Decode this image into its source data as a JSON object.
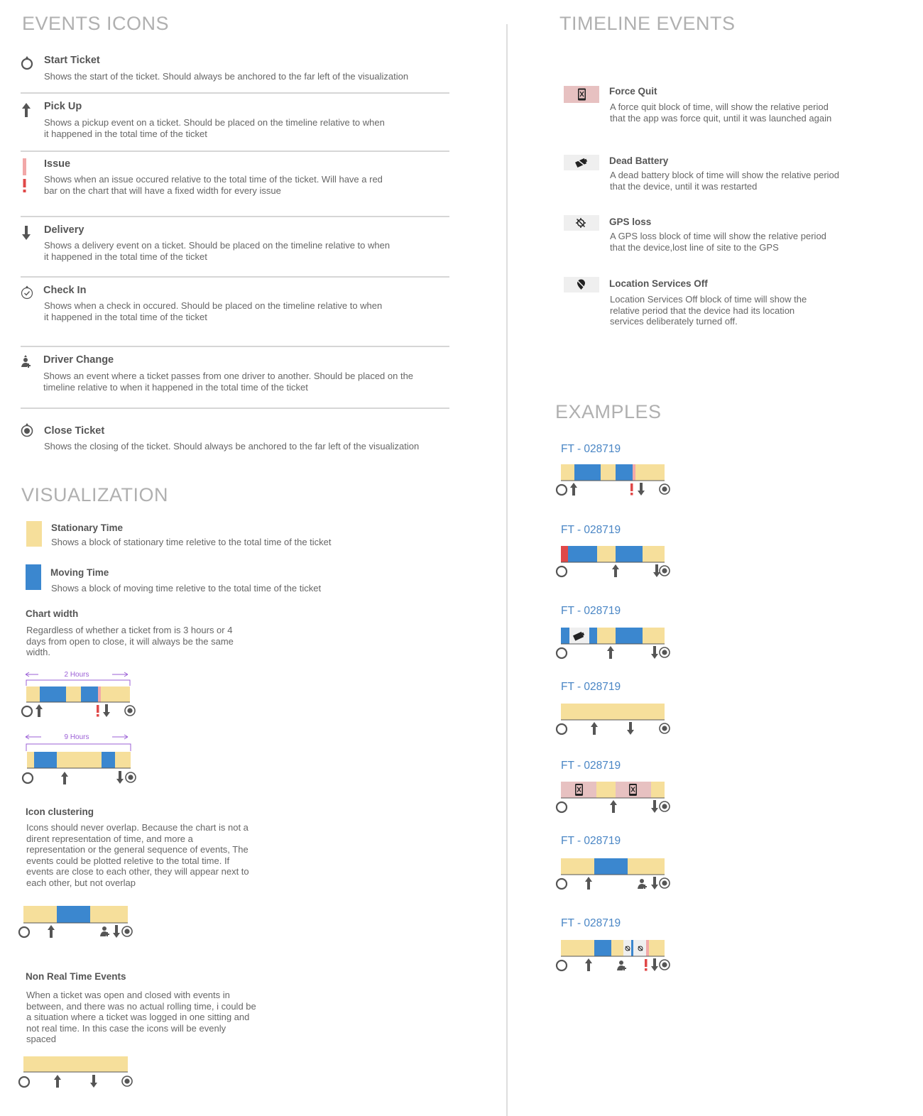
{
  "colors": {
    "stationary": "#f6df9b",
    "moving": "#3b87cf",
    "issue": "#f2a0a0",
    "issue_strong": "#e04848",
    "force_quit": "#e7c1c1",
    "dark_icon": "#555555",
    "heading": "#b0b0b0",
    "purple": "#9b5fd6",
    "label_blue": "#4a86c5"
  },
  "events_icons": {
    "heading": "EVENTS ICONS",
    "items": [
      {
        "icon": "start-circle-icon",
        "title": "Start Ticket",
        "desc": "Shows the start of the ticket. Should always be anchored to the far left of the visualization"
      },
      {
        "icon": "arrow-up-icon",
        "title": "Pick Up",
        "desc": "Shows a pickup  event on a ticket. Should be placed on the timeline relative to when it happened in the total time of the ticket"
      },
      {
        "icon": "issue-exclamation-icon",
        "title": "Issue",
        "desc": "Shows when an issue occured relative to the total time of the ticket. Will have a red bar on the chart that will have a fixed width for every issue"
      },
      {
        "icon": "arrow-down-icon",
        "title": "Delivery",
        "desc": "Shows a delivery event on a ticket. Should be placed on the timeline relative to when it happened in the total time of the ticket"
      },
      {
        "icon": "check-circle-icon",
        "title": "Check In",
        "desc": "Shows when a check in occured. Should be placed on the timeline relative to when it happened in the total time of the ticket"
      },
      {
        "icon": "driver-change-icon",
        "title": "Driver Change",
        "desc": "Shows an event where a ticket passes from one driver to another. Should be placed on the timeline relative to when it happened in the total time of the ticket"
      },
      {
        "icon": "close-circle-icon",
        "title": "Close Ticket",
        "desc": "Shows the closing of the ticket. Should always be anchored to the far left of the visualization"
      }
    ]
  },
  "visualization": {
    "heading": "VISUALIZATION",
    "stationary": {
      "title": "Stationary Time",
      "desc": "Shows a block of stationary time reletive to the total time of the ticket"
    },
    "moving": {
      "title": "Moving Time",
      "desc": "Shows a block of moving time reletive to the total time of the ticket"
    },
    "chart_width": {
      "title": "Chart width",
      "desc": "Regardless of whether a ticket from is 3 hours or 4 days from open to close, it will  always be the same width.",
      "label_a": "2 Hours",
      "label_b": "9 Hours"
    },
    "icon_clustering": {
      "title": "Icon clustering",
      "desc": "Icons should never overlap. Because the chart is not a dirent representation of time, and more a representation or the general sequence of events, The events could be plotted reletive to the total time. If events are close to each other, they will appear next to each other, but not overlap"
    },
    "non_real_time": {
      "title": "Non Real Time Events",
      "desc": "When a ticket was open and closed with events in between, and there was no actual rolling time, i could be a situation where a ticket was logged in one sitting and not real time. In this case the icons will be evenly spaced"
    }
  },
  "timeline_events": {
    "heading": "TIMELINE EVENTS",
    "items": [
      {
        "icon": "phone-x-icon",
        "title": "Force Quit",
        "desc": "A force quit block of time, will show the relative period that the app was force quit, until it was launched again"
      },
      {
        "icon": "dead-battery-icon",
        "title": "Dead Battery",
        "desc": "A dead battery block of time will show the relative period that the device, until it was restarted"
      },
      {
        "icon": "gps-off-icon",
        "title": "GPS loss",
        "desc": "A GPS loss block of time will show the relative period that the device,lost line of site to the GPS"
      },
      {
        "icon": "location-off-icon",
        "title": "Location Services Off",
        "desc": "Location Services Off block of time will show the relative period that the device had its location services deliberately turned off."
      }
    ]
  },
  "examples": {
    "heading": "EXAMPLES",
    "labels": [
      "FT - 028719",
      "FT - 028719",
      "FT - 028719",
      "FT - 028719",
      "FT - 028719",
      "FT - 028719",
      "FT - 028719"
    ]
  }
}
